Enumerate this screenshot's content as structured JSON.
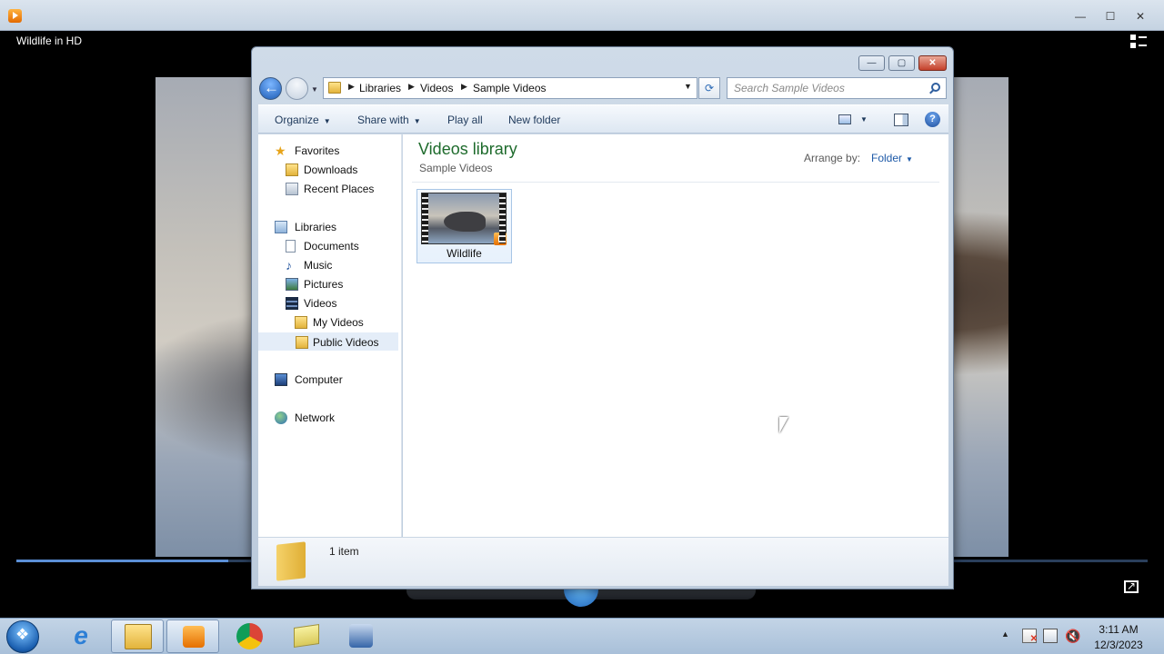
{
  "player": {
    "title": "Wildlife in HD",
    "controls": {
      "minimize": "—",
      "maximize": "☐",
      "close": "✕"
    },
    "progress": 0.187
  },
  "explorer": {
    "controls": {
      "minimize": "—",
      "maximize": "▢",
      "close": "✕"
    },
    "breadcrumb": [
      "Libraries",
      "Videos",
      "Sample Videos"
    ],
    "search_placeholder": "Search Sample Videos",
    "toolbar": {
      "organize": "Organize",
      "share_with": "Share with",
      "play_all": "Play all",
      "new_folder": "New folder",
      "help": "?"
    },
    "nav": {
      "favorites": "Favorites",
      "downloads": "Downloads",
      "recent_places": "Recent Places",
      "libraries": "Libraries",
      "documents": "Documents",
      "music": "Music",
      "pictures": "Pictures",
      "videos": "Videos",
      "my_videos": "My Videos",
      "public_videos": "Public Videos",
      "computer": "Computer",
      "network": "Network"
    },
    "content": {
      "title": "Videos library",
      "subtitle": "Sample Videos",
      "arrange_label": "Arrange by:",
      "arrange_value": "Folder",
      "files": [
        {
          "name": "Wildlife",
          "icon": "video-thumbnail"
        }
      ]
    },
    "details": {
      "count": "1 item"
    }
  },
  "taskbar": {
    "items": [
      "start-orb",
      "internet-explorer-icon",
      "windows-explorer-icon",
      "windows-media-player-icon",
      "chrome-icon",
      "folder-icon",
      "network-tool-icon"
    ],
    "clock": {
      "time": "3:11 AM",
      "date": "12/3/2023"
    }
  },
  "colors": {
    "library_title": "#1e6b2c",
    "link_blue": "#1e5aa8",
    "selection": "#e4edf8"
  }
}
